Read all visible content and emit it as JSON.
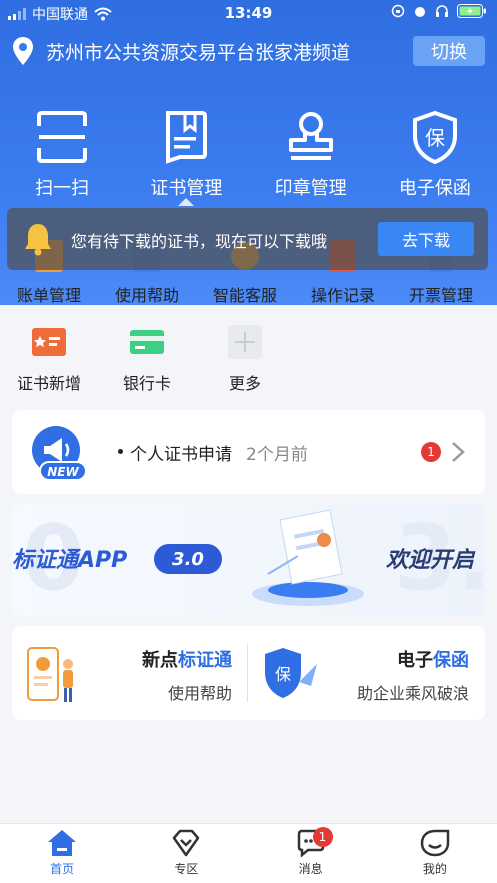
{
  "status_bar": {
    "carrier": "中国联通",
    "time": "13:49"
  },
  "location": {
    "city_label": "苏州市公共资源交易平台张家港频道",
    "switch_label": "切换"
  },
  "top_actions": [
    {
      "label": "扫一扫",
      "icon": "scan-icon"
    },
    {
      "label": "证书管理",
      "icon": "certificate-icon"
    },
    {
      "label": "印章管理",
      "icon": "stamp-icon"
    },
    {
      "label": "电子保函",
      "icon": "guarantee-icon"
    }
  ],
  "notice": {
    "message": "您有待下载的证书，现在可以下载哦",
    "button_label": "去下载"
  },
  "grid_row1": [
    {
      "label": "账单管理"
    },
    {
      "label": "使用帮助"
    },
    {
      "label": "智能客服"
    },
    {
      "label": "操作记录"
    },
    {
      "label": "开票管理"
    }
  ],
  "grid_row2": [
    {
      "label": "证书新增"
    },
    {
      "label": "银行卡"
    },
    {
      "label": "更多"
    }
  ],
  "news": {
    "title": "个人证书申请",
    "time": "2个月前",
    "badge_count": "1",
    "icon_text": "NEW"
  },
  "banner": {
    "app_text": "标证通APP",
    "version": "3.0",
    "welcome": "欢迎开启",
    "bg_left": "0",
    "bg_right": "3."
  },
  "promo_left": {
    "title_plain": "新点",
    "title_highlight": "标证通",
    "subtitle": "使用帮助"
  },
  "promo_right": {
    "title_plain": "电子",
    "title_highlight": "保函",
    "subtitle": "助企业乘风破浪"
  },
  "tabbar": [
    {
      "label": "首页",
      "icon": "home-icon",
      "active": true
    },
    {
      "label": "专区",
      "icon": "diamond-icon"
    },
    {
      "label": "消息",
      "icon": "message-icon",
      "badge": "1"
    },
    {
      "label": "我的",
      "icon": "profile-icon"
    }
  ],
  "colors": {
    "primary": "#2f6fe3",
    "badge": "#e53935"
  }
}
